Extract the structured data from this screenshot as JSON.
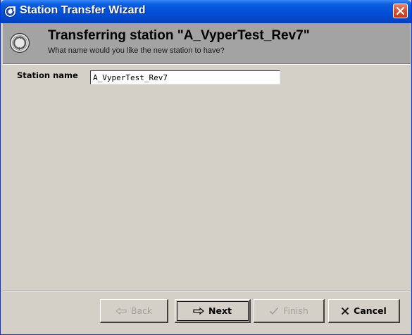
{
  "window": {
    "title": "Station Transfer Wizard"
  },
  "header": {
    "title": "Transferring station \"A_VyperTest_Rev7\"",
    "subtitle": "What name would you like the new station to have?"
  },
  "form": {
    "station_name_label": "Station name",
    "station_name_value": "A_VyperTest_Rev7"
  },
  "buttons": {
    "back": {
      "label": "Back",
      "enabled": false,
      "icon": "arrow-left-icon"
    },
    "next": {
      "label": "Next",
      "enabled": true,
      "icon": "arrow-right-icon"
    },
    "finish": {
      "label": "Finish",
      "enabled": false,
      "icon": "checkmark-icon"
    },
    "cancel": {
      "label": "Cancel",
      "enabled": true,
      "icon": "x-icon"
    }
  },
  "colors": {
    "titlebar": "#0450d8",
    "header_bg": "#a3a3a3",
    "dialog_bg": "#d4d0c8"
  }
}
